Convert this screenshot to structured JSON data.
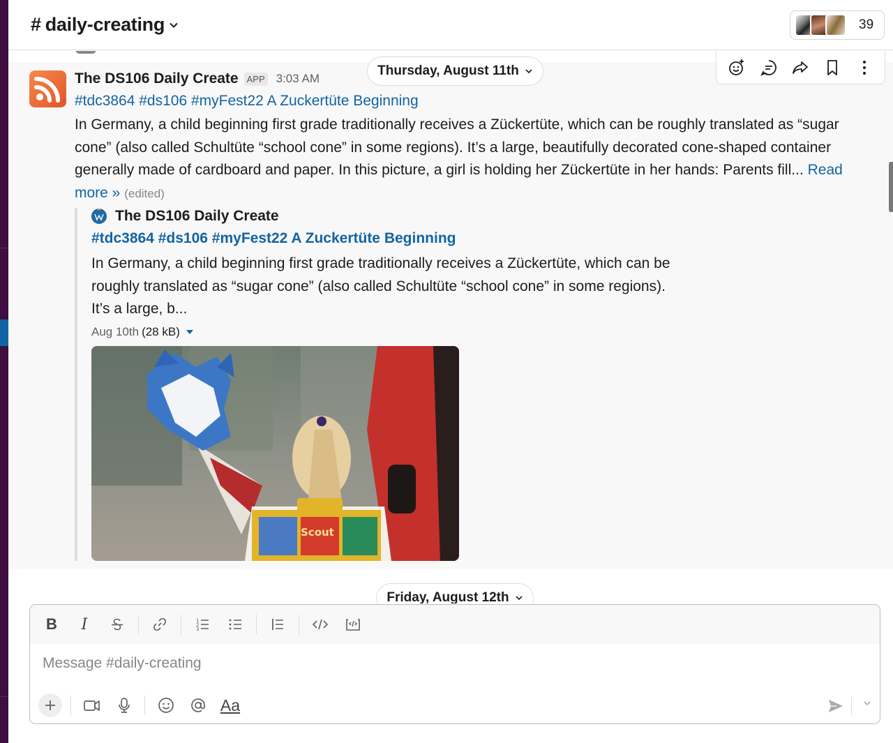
{
  "header": {
    "channel_hash": "#",
    "channel_name": "daily-creating",
    "member_count": "39"
  },
  "dates": {
    "first": "Thursday, August 11th",
    "second": "Friday, August 12th"
  },
  "message": {
    "sender": "The DS106 Daily Create",
    "badge": "APP",
    "time": "3:03 AM",
    "title": "#tdc3864 #ds106 #myFest22 A Zuckertüte Beginning",
    "body": "In Germany, a child beginning first grade traditionally receives a Zückertüte, which can be roughly translated as “sugar cone” (also called Schultüte “school cone” in some regions). It’s a large, beautifully decorated cone-shaped container generally made of cardboard and paper. In this picture, a girl is holding her Zückertüte in her hands:   Parents fill... ",
    "read_more": "Read more »",
    "edited": "(edited)"
  },
  "attachment": {
    "author": "The DS106 Daily Create",
    "title": "#tdc3864 #ds106 #myFest22 A Zuckertüte Beginning",
    "text": "In Germany, a child beginning first grade traditionally receives a Zückertüte, which can be roughly translated as “sugar cone” (also called Schultüte “school cone” in some regions). It’s a large, b...",
    "date": "Aug 10th",
    "size": "(28 kB)",
    "image_caption_text": "Scout"
  },
  "composer": {
    "placeholder": "Message #daily-creating",
    "format_bold": "B",
    "format_italic": "I",
    "format_text_label": "Aa"
  },
  "icons": {
    "actions": [
      "add-reaction-icon",
      "reply-in-thread-icon",
      "forward-icon",
      "bookmark-icon",
      "more-actions-icon"
    ],
    "format": [
      "bold-icon",
      "italic-icon",
      "strikethrough-icon",
      "link-icon",
      "ordered-list-icon",
      "bullet-list-icon",
      "blockquote-icon",
      "code-icon",
      "code-block-icon"
    ],
    "bottom": [
      "plus-icon",
      "video-icon",
      "microphone-icon",
      "emoji-icon",
      "mention-icon",
      "text-format-icon",
      "send-icon",
      "chevron-down-icon"
    ]
  },
  "colors": {
    "link": "#1264a3",
    "sidebar": "#3f0e40",
    "rss_orange": "#e2542a"
  }
}
